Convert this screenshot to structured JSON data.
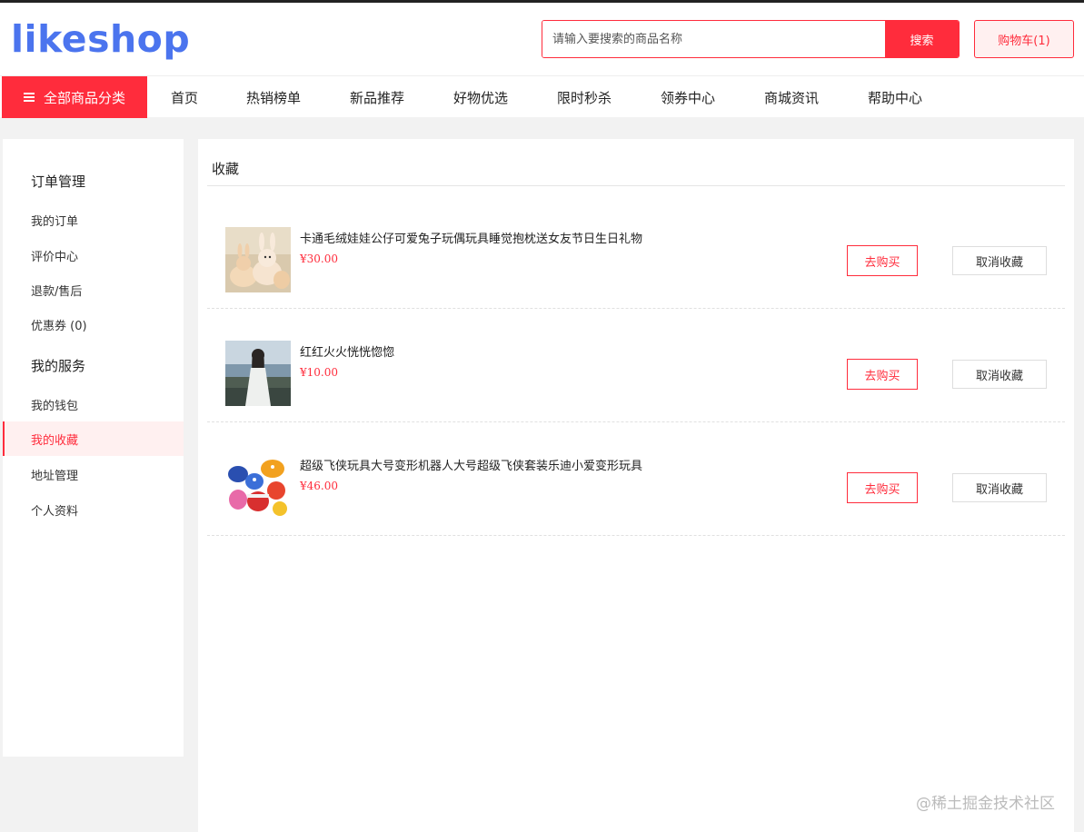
{
  "header": {
    "logo": "likeshop",
    "search_placeholder": "请输入要搜索的商品名称",
    "search_button": "搜索",
    "cart_label": "购物车(1)"
  },
  "nav": {
    "category_button": "全部商品分类",
    "items": [
      "首页",
      "热销榜单",
      "新品推荐",
      "好物优选",
      "限时秒杀",
      "领券中心",
      "商城资讯",
      "帮助中心"
    ]
  },
  "sidebar": {
    "group_orders": "订单管理",
    "my_orders": "我的订单",
    "reviews": "评价中心",
    "refunds": "退款/售后",
    "coupons": "优惠券 (0)",
    "group_services": "我的服务",
    "wallet": "我的钱包",
    "favorites": "我的收藏",
    "address": "地址管理",
    "profile": "个人资料"
  },
  "main": {
    "title": "收藏",
    "buy_label": "去购买",
    "cancel_label": "取消收藏",
    "items": [
      {
        "name": "卡通毛绒娃娃公仔可爱兔子玩偶玩具睡觉抱枕送女友节日生日礼物",
        "price": "¥30.00",
        "image": "plush-bunny-image"
      },
      {
        "name": "红红火火恍恍惚惚",
        "price": "¥10.00",
        "image": "girl-seaside-image"
      },
      {
        "name": "超级飞侠玩具大号变形机器人大号超级飞侠套装乐迪小爱变形玩具",
        "price": "¥46.00",
        "image": "super-wings-toys-image"
      }
    ]
  },
  "watermark": "@稀土掘金技术社区",
  "colors": {
    "accent": "#ff2c3c",
    "logo": "#4b74ee",
    "active_bg": "#fff0f0"
  }
}
